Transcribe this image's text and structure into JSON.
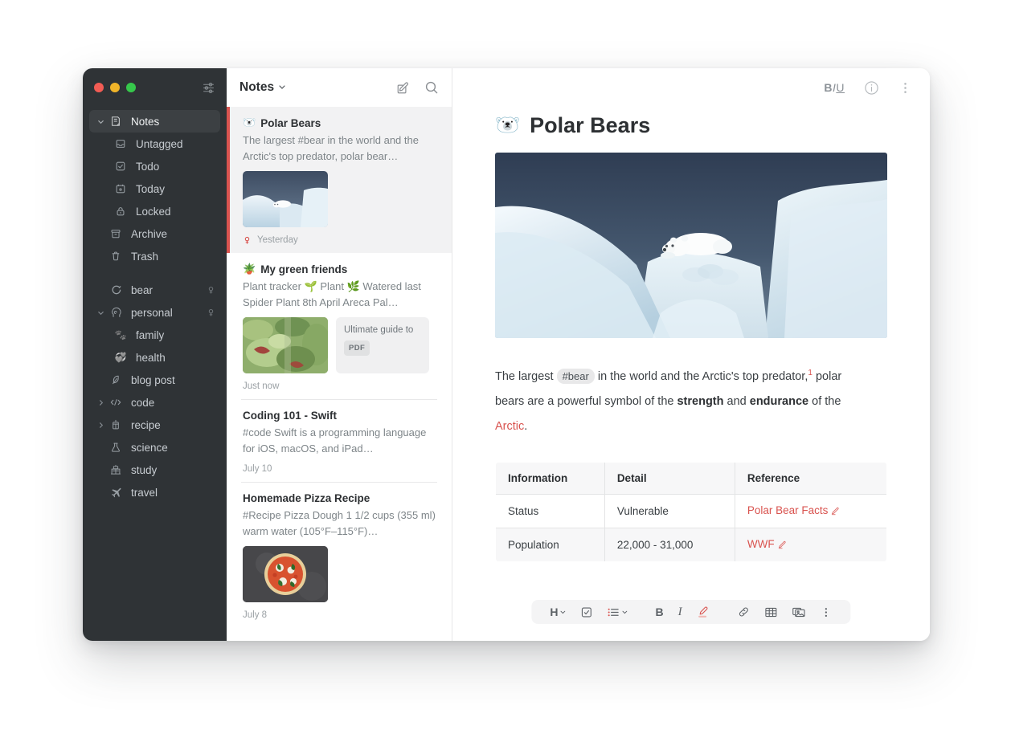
{
  "window": {
    "traffic_lights": [
      "close",
      "minimize",
      "maximize"
    ],
    "settings_icon": "sliders-icon"
  },
  "sidebar": {
    "items": [
      {
        "label": "Notes",
        "icon": "note-icon",
        "indent": 0,
        "caret": "down",
        "selected": true,
        "pin": false
      },
      {
        "label": "Untagged",
        "icon": "inbox-icon",
        "indent": 1,
        "caret": "none",
        "selected": false,
        "pin": false
      },
      {
        "label": "Todo",
        "icon": "checkbox-icon",
        "indent": 1,
        "caret": "none",
        "selected": false,
        "pin": false
      },
      {
        "label": "Today",
        "icon": "calendar-icon",
        "indent": 1,
        "caret": "none",
        "selected": false,
        "pin": false
      },
      {
        "label": "Locked",
        "icon": "lock-icon",
        "indent": 1,
        "caret": "none",
        "selected": false,
        "pin": false
      },
      {
        "label": "Archive",
        "icon": "archive-icon",
        "indent": 0,
        "caret": "none",
        "selected": false,
        "pin": false
      },
      {
        "label": "Trash",
        "icon": "trash-icon",
        "indent": 0,
        "caret": "none",
        "selected": false,
        "pin": false
      }
    ],
    "tags": [
      {
        "label": "bear",
        "icon": "bear-icon",
        "indent": 0,
        "caret": "none",
        "pin": true
      },
      {
        "label": "personal",
        "icon": "head-icon",
        "indent": 0,
        "caret": "down",
        "pin": true
      },
      {
        "label": "family",
        "icon": "paw-emoji",
        "indent": 1,
        "caret": "none",
        "pin": false,
        "emoji": "🐾"
      },
      {
        "label": "health",
        "icon": "heart-emoji",
        "indent": 1,
        "caret": "none",
        "pin": false,
        "emoji": "💞"
      },
      {
        "label": "blog post",
        "icon": "feather-icon",
        "indent": 0,
        "caret": "none",
        "pin": false
      },
      {
        "label": "code",
        "icon": "code-icon",
        "indent": 0,
        "caret": "right",
        "pin": false
      },
      {
        "label": "recipe",
        "icon": "grater-icon",
        "indent": 0,
        "caret": "right",
        "pin": false
      },
      {
        "label": "science",
        "icon": "flask-icon",
        "indent": 0,
        "caret": "none",
        "pin": false
      },
      {
        "label": "study",
        "icon": "school-icon",
        "indent": 0,
        "caret": "none",
        "pin": false
      },
      {
        "label": "travel",
        "icon": "plane-icon",
        "indent": 0,
        "caret": "none",
        "pin": false
      }
    ]
  },
  "note_list": {
    "title": "Notes",
    "title_caret": "chevron-down-icon",
    "compose_icon": "compose-icon",
    "search_icon": "search-icon",
    "notes": [
      {
        "emoji": "🐻‍❄️",
        "title": "Polar Bears",
        "snippet": "The largest #bear in the world and the Arctic's top predator, polar bear…",
        "meta": "Yesterday",
        "pinned": true,
        "active": true,
        "thumb": "polar-bear-thumb",
        "attachment": null
      },
      {
        "emoji": "🪴",
        "title": "My green friends",
        "snippet": "Plant tracker 🌱 Plant 🌿 Watered last Spider Plant 8th April Areca Pal…",
        "meta": "Just now",
        "pinned": false,
        "active": false,
        "thumb": "plants-thumb",
        "attachment": {
          "name": "Ultimate guide to",
          "badge": "PDF"
        }
      },
      {
        "emoji": "",
        "title": "Coding 101 - Swift",
        "snippet": "#code Swift is a programming language for iOS, macOS, and iPad…",
        "meta": "July 10",
        "pinned": false,
        "active": false,
        "thumb": null,
        "attachment": null
      },
      {
        "emoji": "",
        "title": "Homemade Pizza Recipe",
        "snippet": "#Recipe Pizza Dough 1 1/2 cups (355 ml) warm water (105°F–115°F)…",
        "meta": "July 8",
        "pinned": false,
        "active": false,
        "thumb": "pizza-thumb",
        "attachment": null
      }
    ]
  },
  "editor": {
    "format_label_b": "B",
    "format_label_i": "I",
    "format_label_u": "U",
    "info_icon": "info-icon",
    "more_icon": "more-vertical-icon",
    "doc_emoji": "🐻‍❄️",
    "doc_title": "Polar Bears",
    "hero_image": "polar-bear-hero",
    "paragraph": {
      "p1": "The largest",
      "tag": "#bear",
      "p2": "in the world and the Arctic's top predator,",
      "footnote": "1",
      "p3": "polar bears are a powerful symbol of the",
      "bold1": "strength",
      "p4": "and",
      "bold2": "endurance",
      "p5": "of the",
      "link": "Arctic",
      "p6": "."
    },
    "table": {
      "headers": [
        "Information",
        "Detail",
        "Reference"
      ],
      "rows": [
        [
          "Status",
          "Vulnerable",
          "Polar Bear Facts"
        ],
        [
          "Population",
          "22,000 - 31,000",
          "WWF"
        ]
      ]
    },
    "toolbar": [
      {
        "name": "heading",
        "label": "H",
        "caret": true
      },
      {
        "name": "checklist",
        "label": "",
        "caret": false
      },
      {
        "name": "list",
        "label": "",
        "caret": true
      },
      {
        "name": "bold",
        "label": "B",
        "caret": false
      },
      {
        "name": "italic",
        "label": "I",
        "caret": false
      },
      {
        "name": "highlight",
        "label": "",
        "caret": false
      },
      {
        "name": "link",
        "label": "",
        "caret": false
      },
      {
        "name": "table",
        "label": "",
        "caret": false
      },
      {
        "name": "image",
        "label": "",
        "caret": false
      },
      {
        "name": "more",
        "label": "",
        "caret": false
      }
    ]
  },
  "colors": {
    "sidebar_bg": "#2f3336",
    "accent_red": "#d9534f",
    "selected_row": "#3c4043",
    "list_active": "#f2f2f3"
  }
}
